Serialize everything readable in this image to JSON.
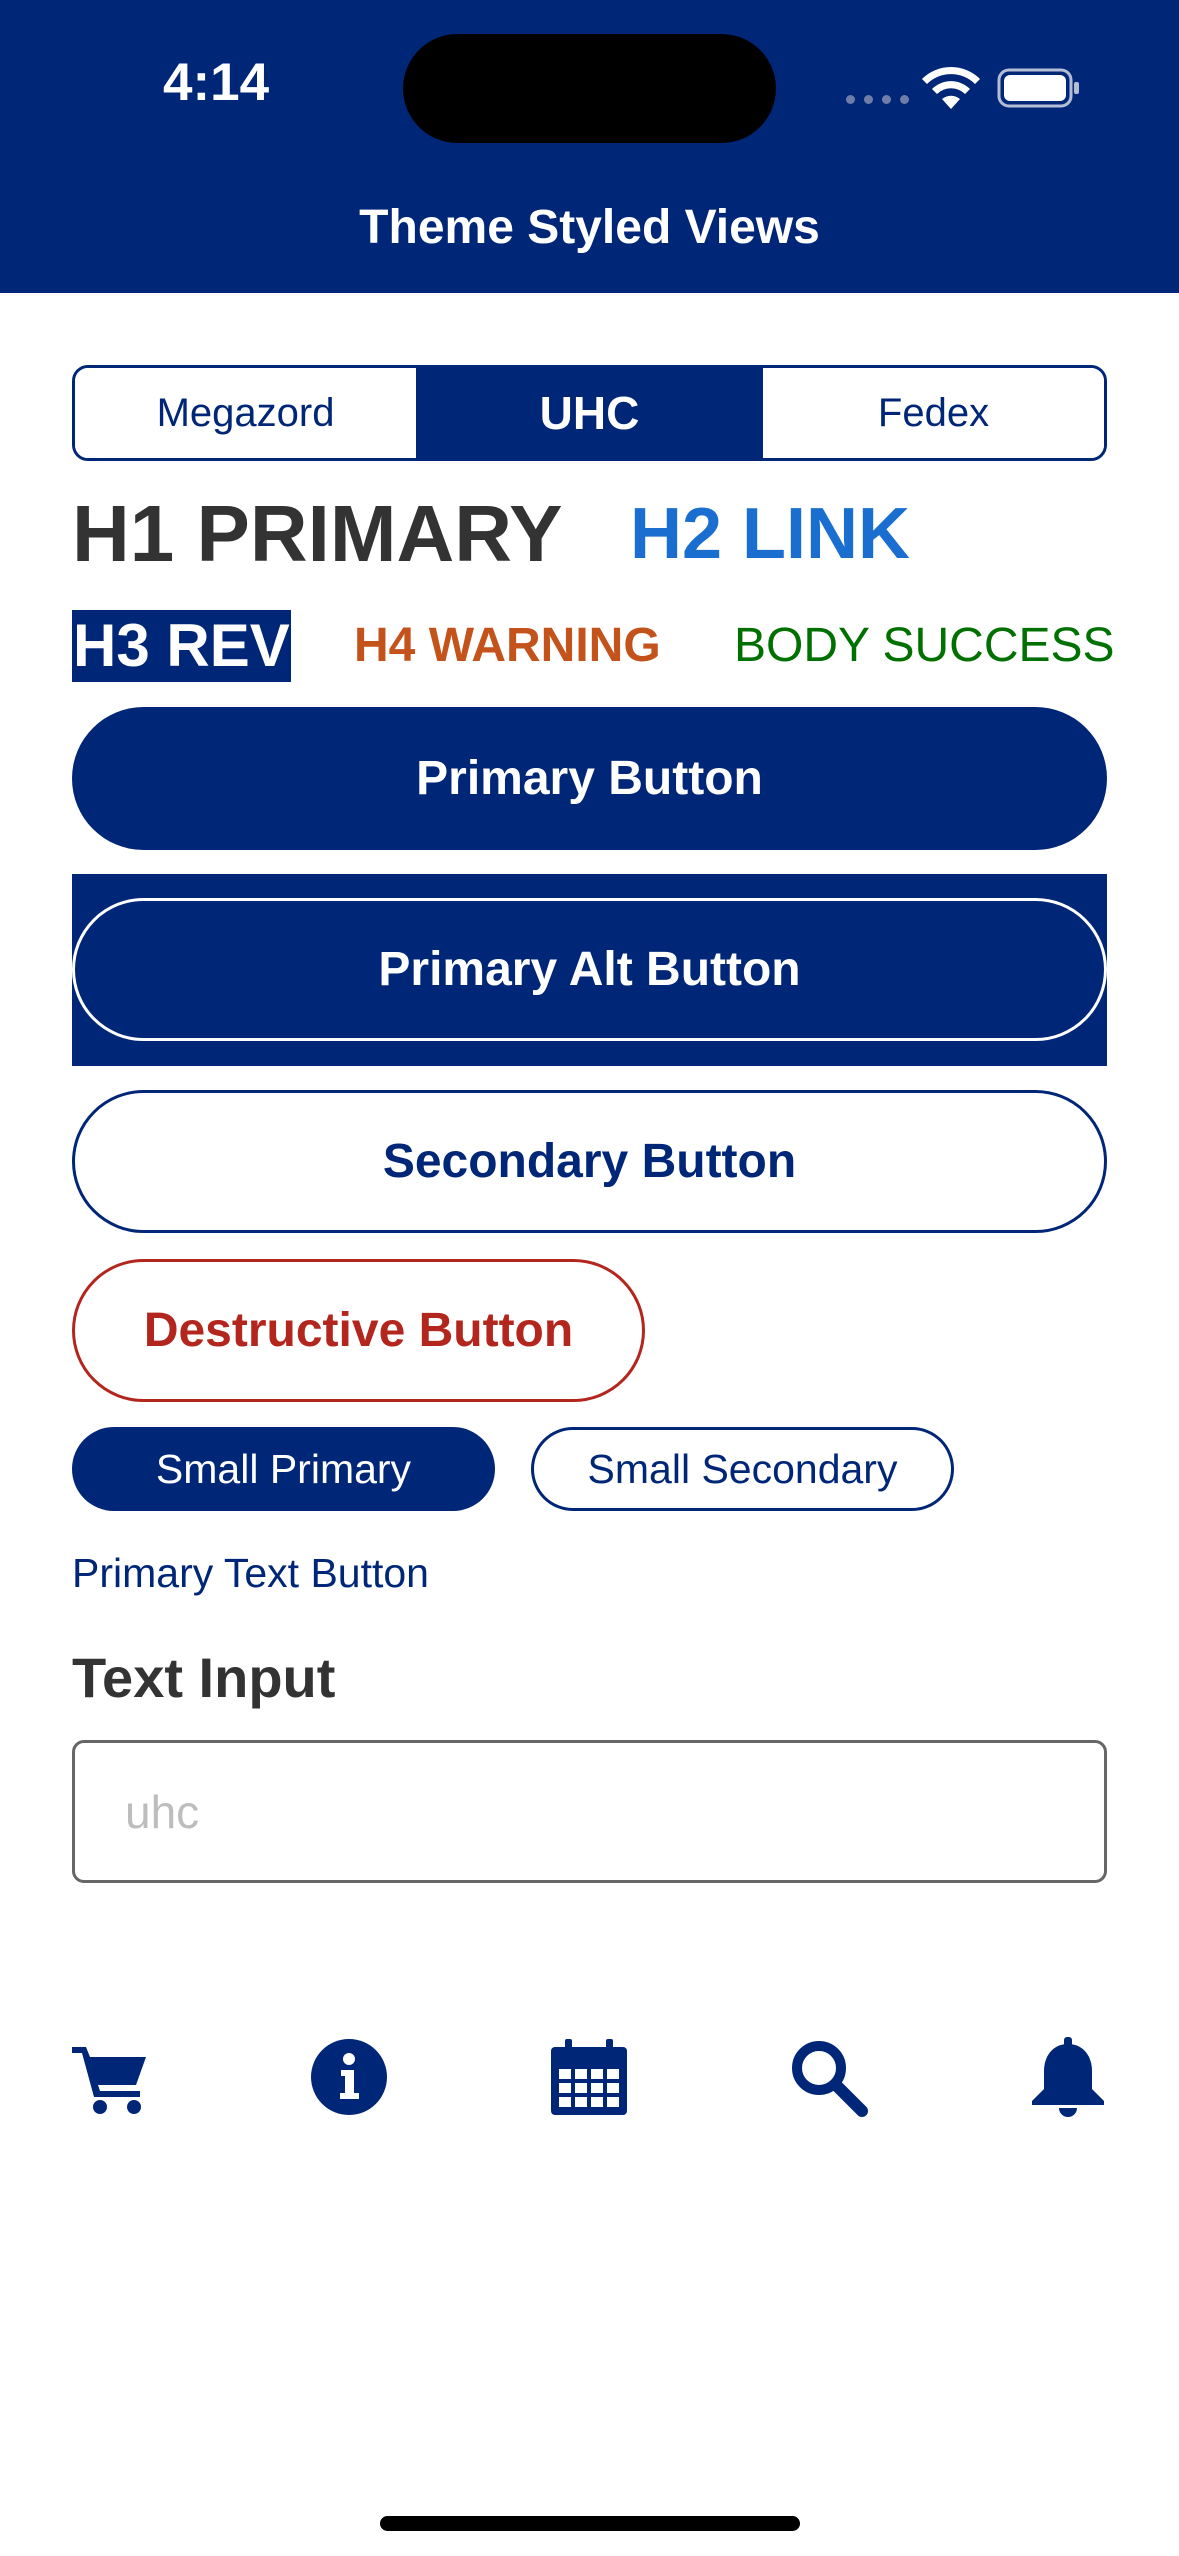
{
  "status_bar": {
    "time": "4:14"
  },
  "nav": {
    "title": "Theme Styled Views"
  },
  "segmented": {
    "segments": [
      "Megazord",
      "UHC",
      "Fedex"
    ],
    "selected": "UHC"
  },
  "typography": {
    "h1": "H1 PRIMARY",
    "h2": "H2 LINK",
    "h3": "H3 REV",
    "h4": "H4 WARNING",
    "body": "BODY SUCCESS"
  },
  "buttons": {
    "primary": "Primary Button",
    "primary_alt": "Primary Alt Button",
    "secondary": "Secondary Button",
    "destructive": "Destructive Button",
    "small_primary": "Small Primary",
    "small_secondary": "Small Secondary",
    "text_button": "Primary Text Button"
  },
  "text_input": {
    "label": "Text Input",
    "placeholder": "uhc",
    "value": ""
  },
  "icons": [
    "cart-icon",
    "info-icon",
    "calendar-icon",
    "search-icon",
    "bell-icon"
  ],
  "colors": {
    "primary": "#002677",
    "link": "#196ECF",
    "warning": "#C4531B",
    "success": "#007000",
    "destructive": "#B3261E",
    "text": "#333333"
  }
}
